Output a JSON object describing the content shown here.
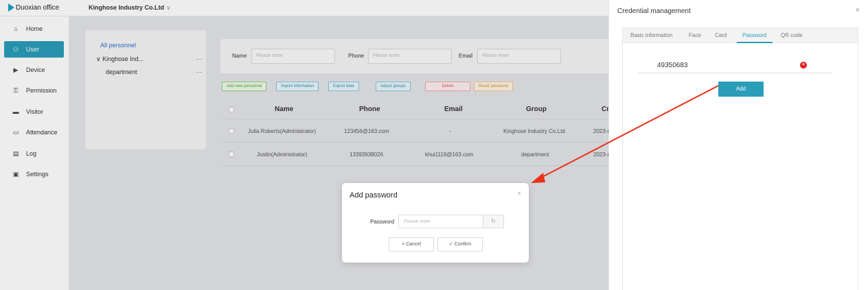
{
  "app": {
    "name": "Duoxian office",
    "company": "Kinghose Industry Co.Ltd",
    "company_chevron": "∨"
  },
  "sidebar": {
    "items": [
      {
        "label": "Home",
        "icon": "⌂"
      },
      {
        "label": "User",
        "icon": "⚇"
      },
      {
        "label": "Device",
        "icon": "▶"
      },
      {
        "label": "Permission",
        "icon": "⚿"
      },
      {
        "label": "Visitor",
        "icon": "▬"
      },
      {
        "label": "Attendance",
        "icon": "▭"
      },
      {
        "label": "Log",
        "icon": "▤"
      },
      {
        "label": "Settings",
        "icon": "▣"
      }
    ]
  },
  "tree": {
    "all": "All personnel",
    "nodes": [
      {
        "label": "∨  Kinghose Ind...",
        "more": "···"
      },
      {
        "label": "department",
        "more": "···"
      }
    ]
  },
  "filters": {
    "name_label": "Name",
    "name_placeholder": "Please enter",
    "phone_label": "Phone",
    "phone_placeholder": "Please enter",
    "email_label": "Email",
    "email_placeholder": "Please enter"
  },
  "actions": {
    "add": "Add new personnel",
    "import": "Import information",
    "export": "Export data",
    "adjust": "Adjust groups",
    "delete": "Delete",
    "reset": "Reset password"
  },
  "table": {
    "headers": [
      "Name",
      "Phone",
      "Email",
      "Group",
      "Cr"
    ],
    "rows": [
      [
        "Julia Roberts(Administrator)",
        "123456@163.com",
        "-",
        "Kinghose Industry Co.Ltd",
        "2023-("
      ],
      [
        "Justin(Administrator)",
        "13393938026",
        "khui1119@163.com",
        "department",
        "2023-("
      ]
    ]
  },
  "drawer": {
    "title": "Credential management",
    "close": "×",
    "tabs": [
      "Basic information",
      "Face",
      "Card",
      "Password",
      "QR code"
    ],
    "password_value": "49350683",
    "delete_glyph": "×",
    "add_label": "Add"
  },
  "modal": {
    "title": "Add password",
    "close": "×",
    "label": "Password",
    "placeholder": "Please enter",
    "suffix_icon": "↻",
    "cancel": "× Cancel",
    "confirm": "✓ Confirm"
  },
  "colors": {
    "accent": "#2a9db9",
    "arrow": "#e8321c",
    "danger": "#e02020"
  }
}
